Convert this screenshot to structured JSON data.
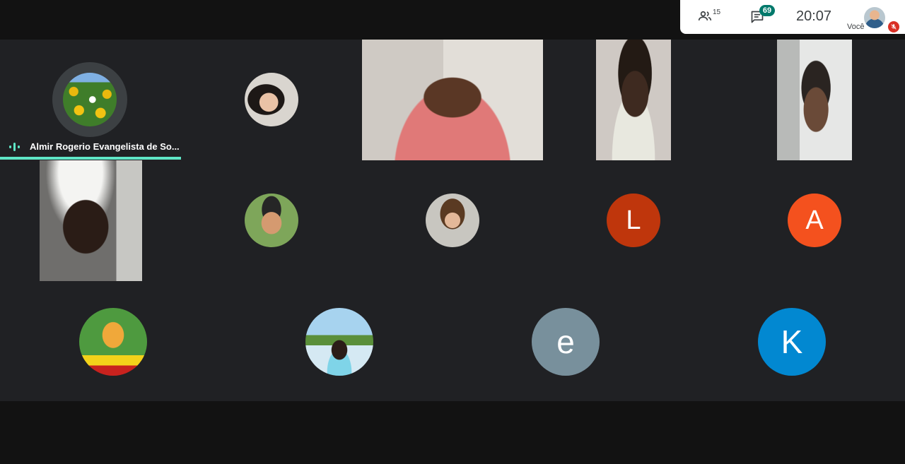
{
  "header": {
    "participants_count": "15",
    "chat_badge": "69",
    "clock": "20:07",
    "self_label": "Você"
  },
  "speaker": {
    "name": "Almir Rogerio Evangelista de So..."
  },
  "tiles": {
    "l_letter": "L",
    "a_letter": "A",
    "e_letter": "e",
    "k_letter": "K"
  },
  "colors": {
    "stage_bg": "#202124",
    "outer_bg": "#121212",
    "speaking_indicator": "#5fe6c6",
    "chat_badge": "#00796b",
    "avatar_l": "#bf360c",
    "avatar_a": "#f4511e",
    "avatar_e": "#78909c",
    "avatar_k": "#0288d1",
    "mic_off": "#d93025"
  },
  "icons": [
    "people-icon",
    "chat-icon",
    "mic-off-icon",
    "audio-level-icon"
  ]
}
